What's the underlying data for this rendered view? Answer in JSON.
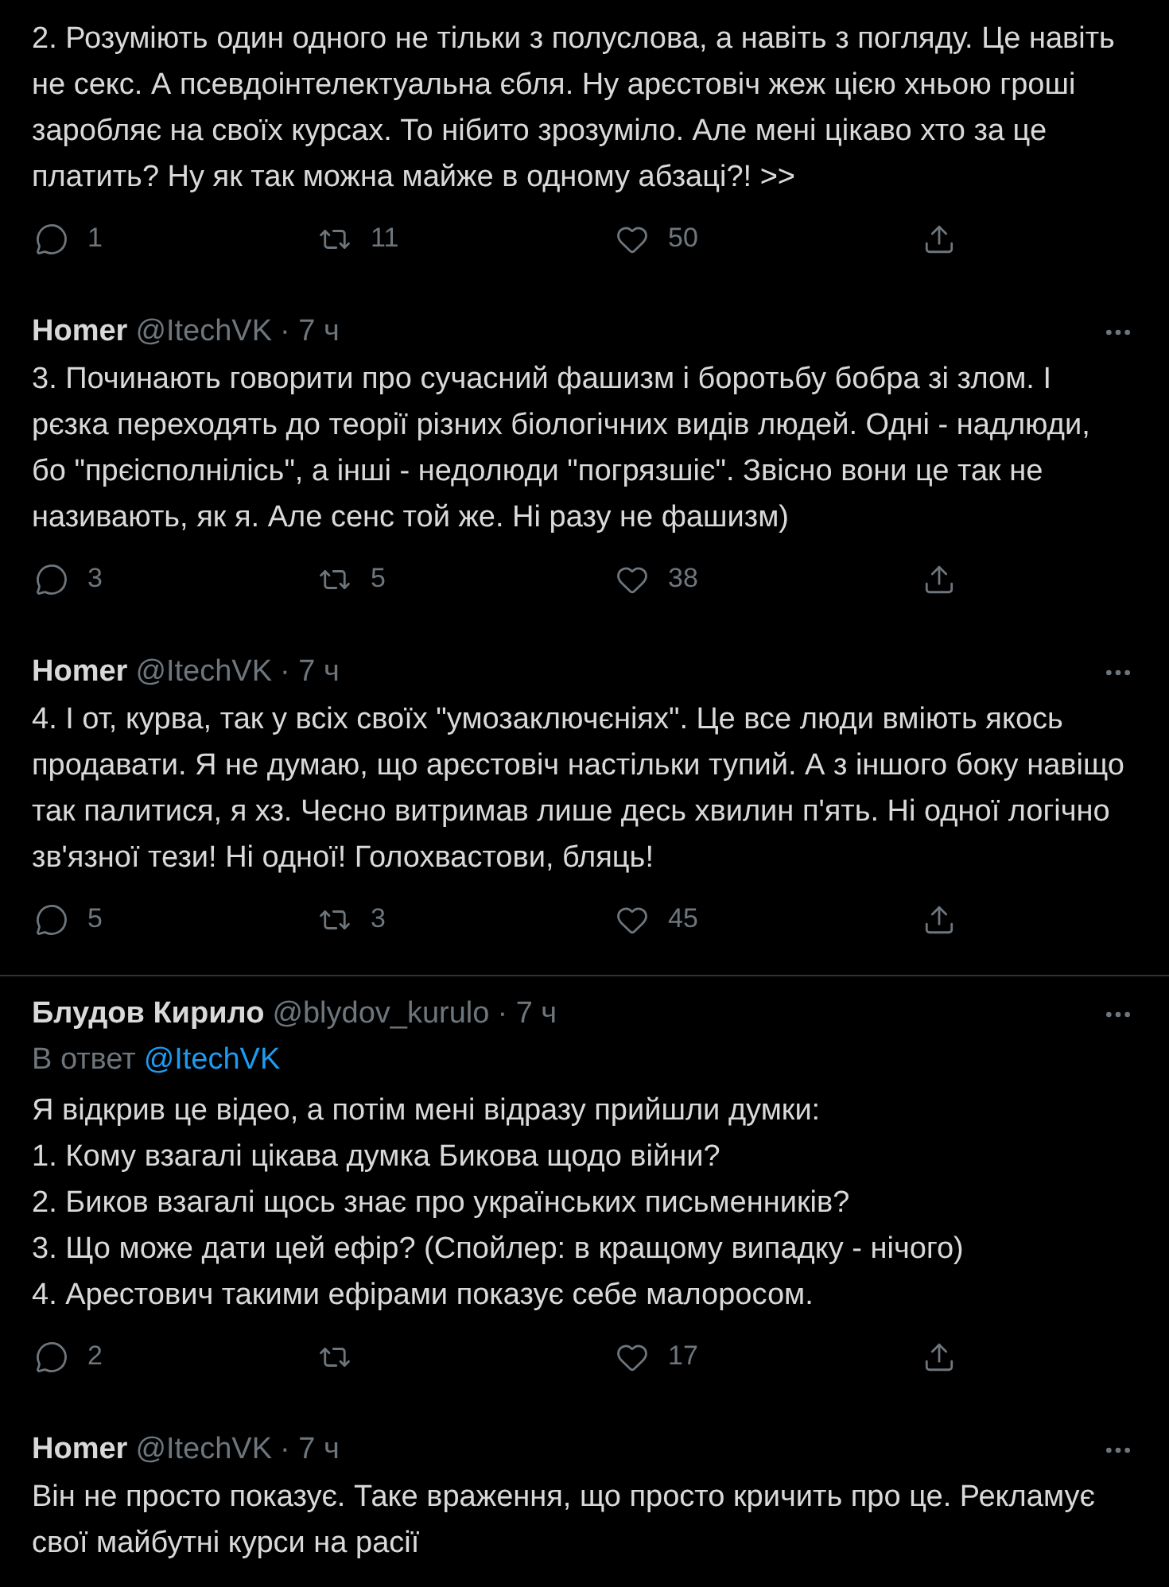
{
  "tweets": [
    {
      "text": "2. Розуміють один одного не тільки з полуслова, а навіть з погляду. Це навіть не секс. А псевдоінтелектуальна єбля. Ну арєстовіч жеж цією хньою гроші заробляє на своїх курсах. То нібито зрозуміло. Але мені цікаво хто за це платить? Ну як так можна майже в одному абзаці?! >>",
      "stats": {
        "replies": "1",
        "retweets": "11",
        "likes": "50"
      }
    },
    {
      "name": "Homer",
      "handle": "@ItechVK",
      "time": "· 7 ч",
      "text": "3. Починають говорити про сучасний фашизм і боротьбу бобра зі злом. І рєзка переходять до теорії різних біологічних видів людей. Одні - надлюди, бо \"прєісполнілісь\", а інші - недолюди \"погрязшіє\". Звісно вони це так не називають, як я. Але сенс той же. Ні разу не фашизм)",
      "stats": {
        "replies": "3",
        "retweets": "5",
        "likes": "38"
      }
    },
    {
      "name": "Homer",
      "handle": "@ItechVK",
      "time": "· 7 ч",
      "text": "4. І от, курва, так у всіх своїх \"умозаключєніях\". Це все люди вміють якось продавати. Я не думаю, що арєстовіч настільки тупий. А з іншого боку навіщо так палитися, я хз. Чесно витримав лише десь хвилин п'ять. Ні одної логічно зв'язної тези! Ні одної! Голохвастови, бляць!",
      "stats": {
        "replies": "5",
        "retweets": "3",
        "likes": "45"
      }
    },
    {
      "name": "Блудов Кирило",
      "handle": "@blydov_kurulo",
      "time": "· 7 ч",
      "reply_label": "В ответ",
      "reply_to": "@ItechVK",
      "text": "Я відкрив це відео, а потім мені відразу прийшли думки:\n1. Кому взагалі цікава думка Бикова щодо війни?\n2. Биков взагалі щось знає про українських письменників?\n3. Що може дати цей ефір? (Спойлер: в кращому випадку - нічого)\n4. Арестович такими ефірами показує себе малоросом.",
      "stats": {
        "replies": "2",
        "likes": "17"
      }
    },
    {
      "name": "Homer",
      "handle": "@ItechVK",
      "time": "· 7 ч",
      "text": "Він не просто показує. Таке враження, що просто кричить про це. Рекламує свої майбутні курси на расії"
    }
  ]
}
